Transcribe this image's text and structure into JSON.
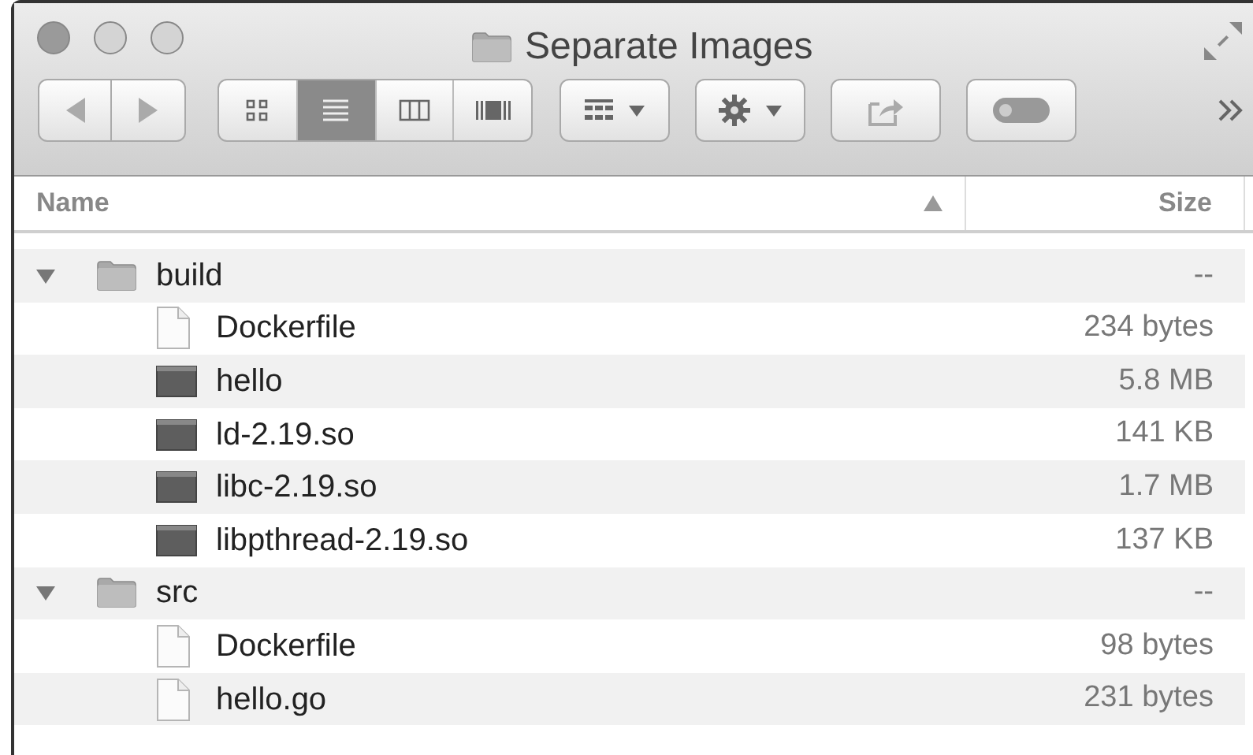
{
  "window": {
    "title": "Separate Images"
  },
  "toolbar": {
    "view_modes": [
      {
        "kind": "icons",
        "selected": false
      },
      {
        "kind": "list",
        "selected": true
      },
      {
        "kind": "columns",
        "selected": false
      },
      {
        "kind": "coverflow",
        "selected": false
      }
    ]
  },
  "columns": [
    {
      "label": "Name",
      "sorted": true
    },
    {
      "label": "Size",
      "sorted": false
    }
  ],
  "items": [
    {
      "kind": "folder",
      "name": "build",
      "size": "--",
      "expanded": true,
      "children": [
        {
          "kind": "document",
          "name": "Dockerfile",
          "size": "234 bytes"
        },
        {
          "kind": "binary",
          "name": "hello",
          "size": "5.8 MB"
        },
        {
          "kind": "binary",
          "name": "ld-2.19.so",
          "size": "141 KB"
        },
        {
          "kind": "binary",
          "name": "libc-2.19.so",
          "size": "1.7 MB"
        },
        {
          "kind": "binary",
          "name": "libpthread-2.19.so",
          "size": "137 KB"
        }
      ]
    },
    {
      "kind": "folder",
      "name": "src",
      "size": "--",
      "expanded": true,
      "children": [
        {
          "kind": "document",
          "name": "Dockerfile",
          "size": "98 bytes"
        },
        {
          "kind": "document",
          "name": "hello.go",
          "size": "231 bytes"
        }
      ]
    }
  ]
}
